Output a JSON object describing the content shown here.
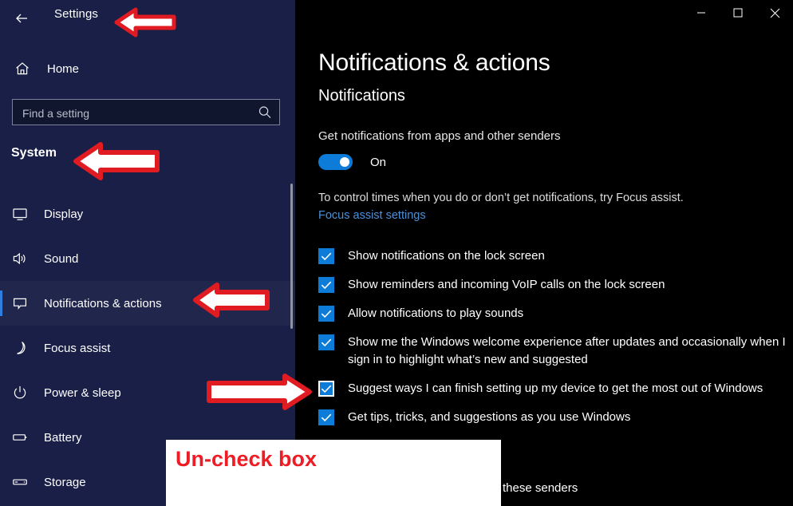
{
  "sidebar": {
    "back_icon": "back-arrow-icon",
    "app_title": "Settings",
    "home": {
      "icon": "home-icon",
      "label": "Home"
    },
    "search": {
      "placeholder": "Find a setting",
      "value": "",
      "icon": "search-icon"
    },
    "section_title": "System",
    "items": [
      {
        "label": "Display",
        "icon": "monitor-icon",
        "selected": false
      },
      {
        "label": "Sound",
        "icon": "speaker-icon",
        "selected": false
      },
      {
        "label": "Notifications & actions",
        "icon": "speech-bubble-icon",
        "selected": true
      },
      {
        "label": "Focus assist",
        "icon": "moon-icon",
        "selected": false
      },
      {
        "label": "Power & sleep",
        "icon": "power-icon",
        "selected": false
      },
      {
        "label": "Battery",
        "icon": "battery-icon",
        "selected": false
      },
      {
        "label": "Storage",
        "icon": "drive-icon",
        "selected": false
      }
    ]
  },
  "window_controls": {
    "minimize": "minimize-icon",
    "maximize": "maximize-icon",
    "close": "close-icon"
  },
  "main": {
    "page_title": "Notifications & actions",
    "subhead": "Notifications",
    "toggle_caption": "Get notifications from apps and other senders",
    "toggle_state": "On",
    "toggle_on": true,
    "focus_note": "To control times when you do or don’t get notifications, try Focus assist.",
    "focus_link": "Focus assist settings",
    "checkboxes": [
      {
        "label": "Show notifications on the lock screen",
        "checked": true,
        "focused": false
      },
      {
        "label": "Show reminders and incoming VoIP calls on the lock screen",
        "checked": true,
        "focused": false
      },
      {
        "label": "Allow notifications to play sounds",
        "checked": true,
        "focused": false
      },
      {
        "label": "Show me the Windows welcome experience after updates and occasionally when I sign in to highlight what’s new and suggested",
        "checked": true,
        "focused": false
      },
      {
        "label": "Suggest ways I can finish setting up my device to get the most out of Windows",
        "checked": true,
        "focused": true
      },
      {
        "label": "Get tips, tricks, and suggestions as you use Windows",
        "checked": true,
        "focused": false
      }
    ],
    "bottom_fragment": "these senders"
  },
  "annotations": {
    "callout_text": "Un-check box",
    "arrow_color_fill": "#ffffff",
    "arrow_color_border": "#e01b22",
    "callout_bg": "#ffffff",
    "callout_text_color": "#ee1c25",
    "arrows": [
      {
        "name": "arrow-settings-title",
        "direction": "left"
      },
      {
        "name": "arrow-system-section",
        "direction": "left"
      },
      {
        "name": "arrow-notifications-actions",
        "direction": "left"
      },
      {
        "name": "arrow-suggest-checkbox",
        "direction": "right"
      }
    ]
  },
  "colors": {
    "sidebar_bg": "#191f47",
    "main_bg": "#000000",
    "accent": "#0d7cd8",
    "link": "#4a90d9",
    "selected_accent": "#2f7ee0"
  }
}
